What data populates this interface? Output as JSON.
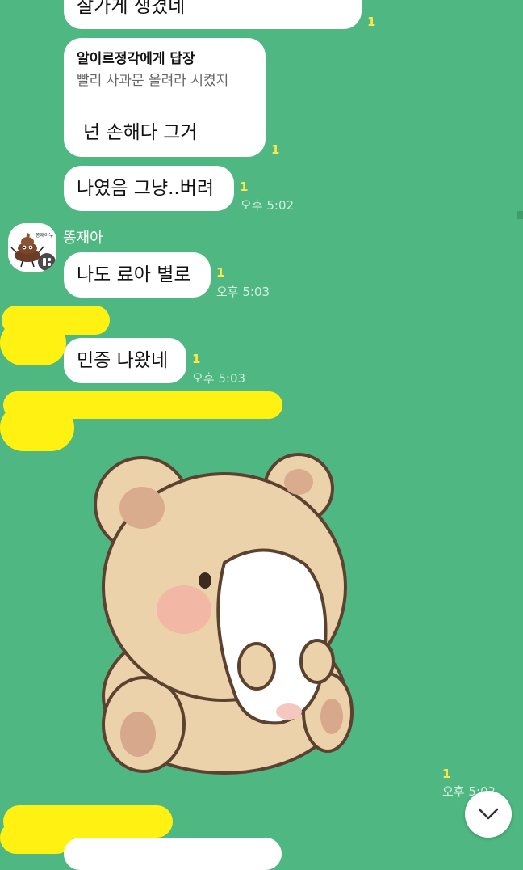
{
  "messages": {
    "m1": {
      "text": "잘가게 생겼네",
      "unread": "1"
    },
    "m2": {
      "reply_to": "알이르정각에게 답장",
      "quoted": "빨리 사과문 올려라 시켰지",
      "text": "넌 손해다 그거",
      "unread": "1"
    },
    "m3": {
      "text": "나였음 그냥..버려",
      "unread": "1",
      "time": "오후 5:02"
    },
    "m4": {
      "sender": "똥재아",
      "text": "나도 료아 별로",
      "unread": "1",
      "time": "오후 5:03"
    },
    "m5": {
      "text": "민증 나왔네",
      "unread": "1",
      "time": "오후 5:03"
    },
    "m6": {
      "sticker": "bear-hugging-pillow-sticker",
      "unread": "1",
      "time": "오후 5:02"
    }
  },
  "avatar": {
    "label": "똥재아누"
  },
  "colors": {
    "background": "#4fb882",
    "bubble": "#ffffff",
    "unread": "#ffe64a",
    "highlight": "#fff212"
  }
}
